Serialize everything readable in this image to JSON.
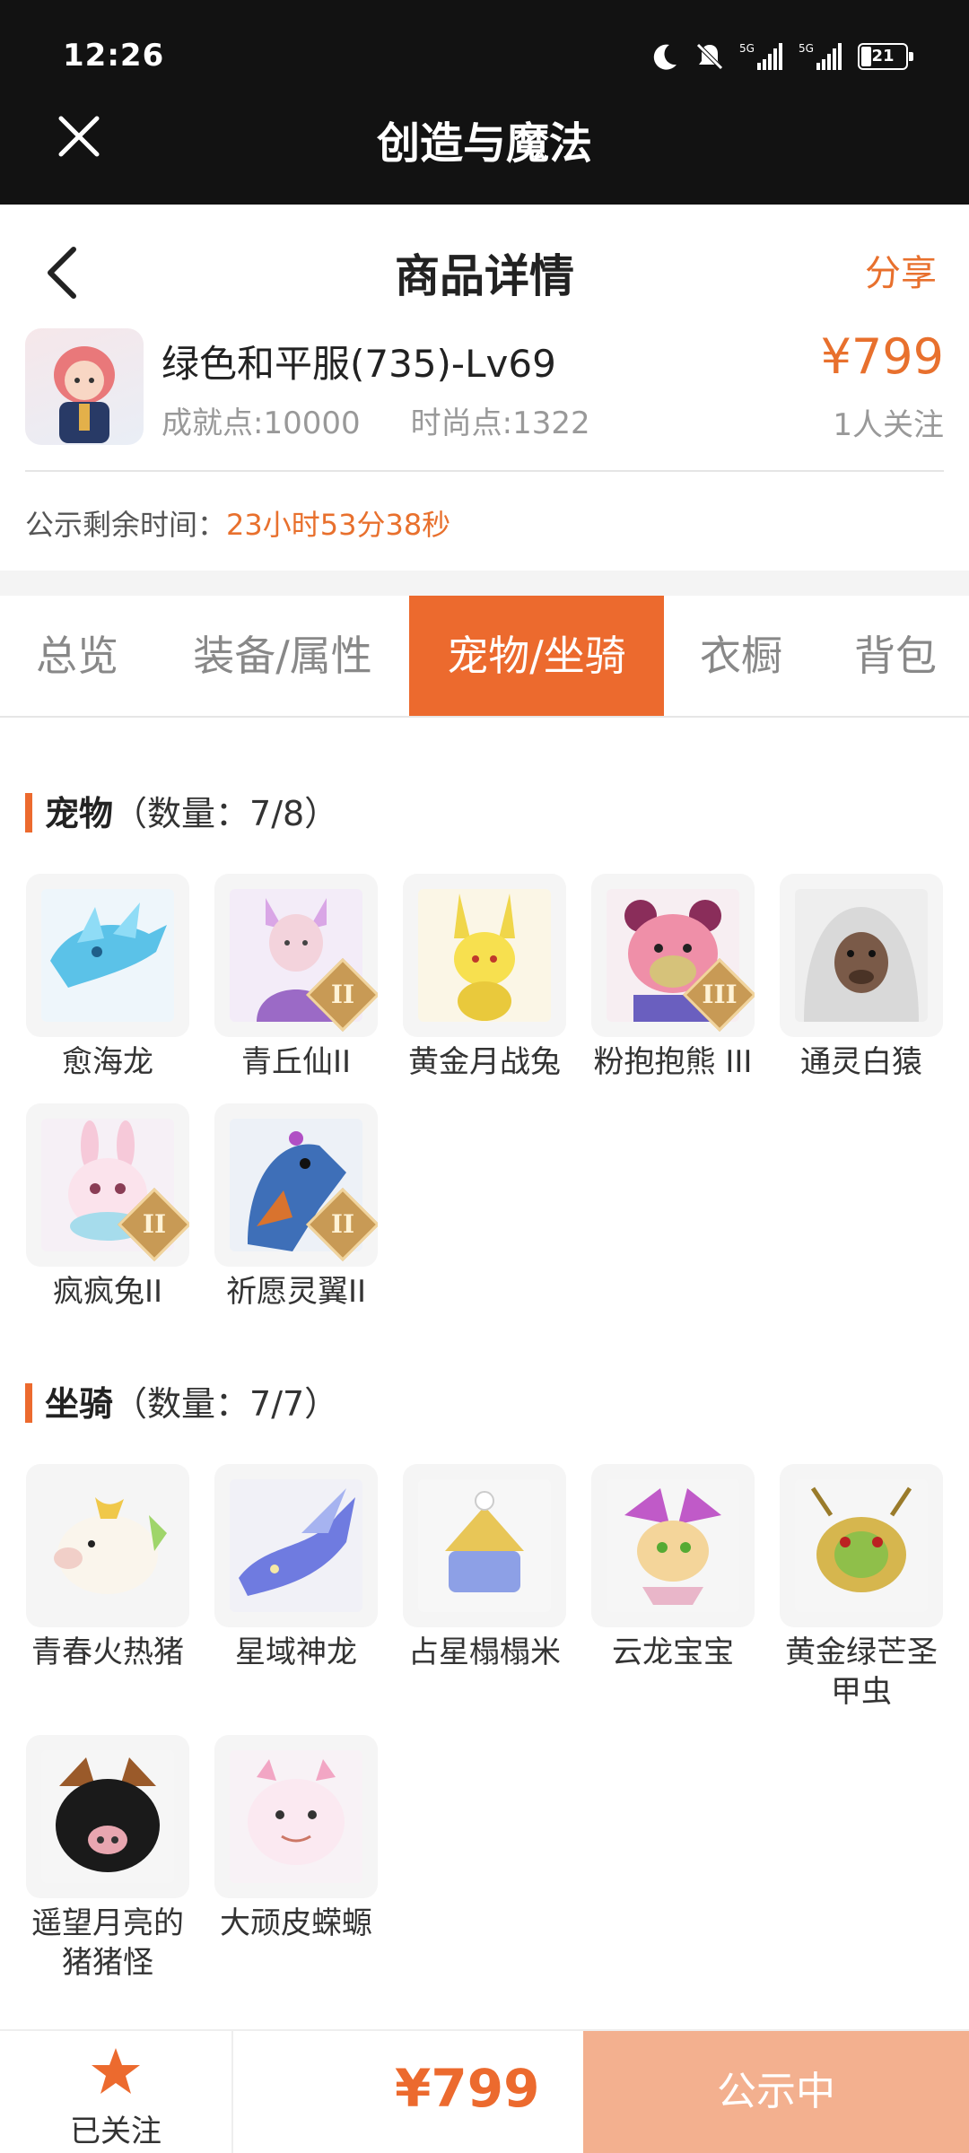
{
  "status_bar": {
    "time": "12:26",
    "battery": "21",
    "network1": "5G",
    "network2": "5G"
  },
  "app_bar": {
    "title": "创造与魔法"
  },
  "header": {
    "title": "商品详情",
    "share": "分享"
  },
  "product": {
    "name": "绿色和平服(735)-Lv69",
    "achievement": "成就点:10000",
    "fashion": "时尚点:1322",
    "price": "¥799",
    "followers": "1人关注"
  },
  "notice": {
    "label": "公示剩余时间：",
    "value": "23小时53分38秒"
  },
  "tabs": [
    "总览",
    "装备/属性",
    "宠物/坐骑",
    "衣橱",
    "背包"
  ],
  "active_tab": "宠物/坐骑",
  "pets": {
    "title": "宠物",
    "count": "（数量：7/8）",
    "items": [
      {
        "name": "愈海龙",
        "badge": ""
      },
      {
        "name": "青丘仙II",
        "badge": "II"
      },
      {
        "name": "黄金月战兔",
        "badge": ""
      },
      {
        "name": "粉抱抱熊 III",
        "badge": "III"
      },
      {
        "name": "通灵白猿",
        "badge": ""
      },
      {
        "name": "疯疯兔II",
        "badge": "II"
      },
      {
        "name": "祈愿灵翼II",
        "badge": "II"
      }
    ]
  },
  "mounts": {
    "title": "坐骑",
    "count": "（数量：7/7）",
    "items": [
      {
        "name": "青春火热猪"
      },
      {
        "name": "星域神龙"
      },
      {
        "name": "占星榻榻米"
      },
      {
        "name": "云龙宝宝"
      },
      {
        "name": "黄金绿芒圣甲虫"
      },
      {
        "name": "遥望月亮的猪猪怪"
      },
      {
        "name": "大顽皮蝾螈"
      }
    ]
  },
  "bottom_bar": {
    "follow_label": "已关注",
    "price": "¥799",
    "status": "公示中"
  },
  "colors": {
    "accent": "#ec6a2e",
    "price": "#e8702d",
    "status_button": "#f3b08f"
  }
}
